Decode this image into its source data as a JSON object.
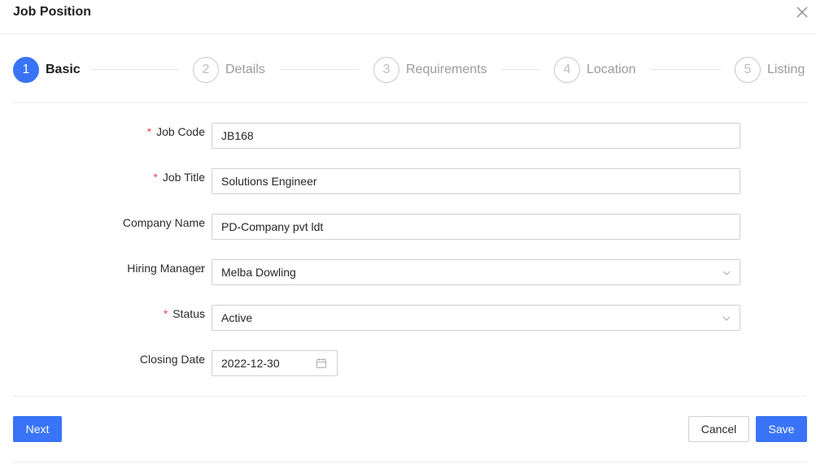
{
  "modal": {
    "title": "Job Position"
  },
  "steps": [
    {
      "number": "1",
      "label": "Basic"
    },
    {
      "number": "2",
      "label": "Details"
    },
    {
      "number": "3",
      "label": "Requirements"
    },
    {
      "number": "4",
      "label": "Location"
    },
    {
      "number": "5",
      "label": "Listing"
    }
  ],
  "active_step": 1,
  "form": {
    "job_code": {
      "label": "Job Code",
      "required": true,
      "value": "JB168"
    },
    "job_title": {
      "label": "Job Title",
      "required": true,
      "value": "Solutions Engineer"
    },
    "company_name": {
      "label": "Company Name",
      "required": false,
      "value": "PD-Company pvt ldt"
    },
    "hiring_manager": {
      "label": "Hiring Manager",
      "required": false,
      "value": "Melba Dowling"
    },
    "status": {
      "label": "Status",
      "required": true,
      "value": "Active"
    },
    "closing_date": {
      "label": "Closing Date",
      "required": false,
      "value": "2022-12-30"
    },
    "colon": ":",
    "required_mark": "*"
  },
  "buttons": {
    "next": "Next",
    "cancel": "Cancel",
    "save": "Save"
  },
  "colors": {
    "primary": "#3874f5",
    "required": "#e5484d"
  },
  "icons": {
    "close": "close-icon",
    "dropdown": "chevron-down-icon",
    "calendar": "calendar-icon"
  }
}
